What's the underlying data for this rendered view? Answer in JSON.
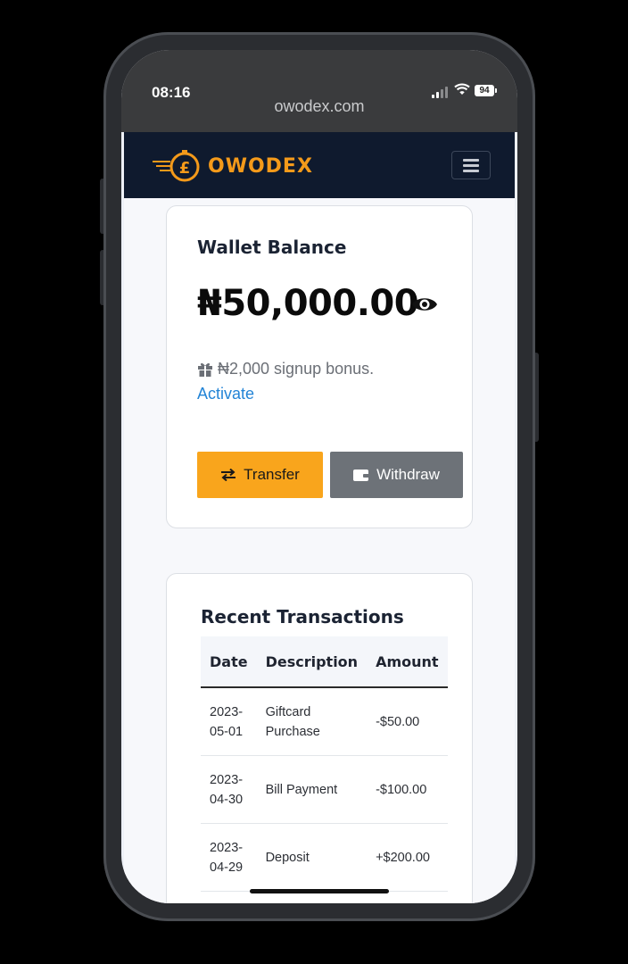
{
  "status_bar": {
    "time": "08:16",
    "battery": "94"
  },
  "browser": {
    "url": "owodex.com"
  },
  "header": {
    "brand": "OWODEX",
    "colors": {
      "brand": "#f49a1a",
      "header_bg": "#0f1a2e"
    }
  },
  "wallet": {
    "title": "Wallet Balance",
    "amount": "₦50,000.00",
    "bonus_text": "₦2,000 signup bonus.",
    "activate_label": "Activate",
    "transfer_label": "Transfer",
    "withdraw_label": "Withdraw",
    "colors": {
      "transfer": "#f9a51c",
      "withdraw": "#6d7278",
      "link": "#2384d6"
    }
  },
  "transactions": {
    "title": "Recent Transactions",
    "columns": [
      "Date",
      "Description",
      "Amount"
    ],
    "rows": [
      {
        "date": "2023-05-01",
        "description": "Giftcard Purchase",
        "amount": "-$50.00"
      },
      {
        "date": "2023-04-30",
        "description": "Bill Payment",
        "amount": "-$100.00"
      },
      {
        "date": "2023-04-29",
        "description": "Deposit",
        "amount": "+$200.00"
      }
    ]
  },
  "icons": [
    "signal-icon",
    "wifi-icon",
    "battery-icon",
    "logo-coin-icon",
    "hamburger-menu-icon",
    "eye-icon",
    "gift-icon",
    "transfer-arrows-icon",
    "wallet-icon"
  ]
}
